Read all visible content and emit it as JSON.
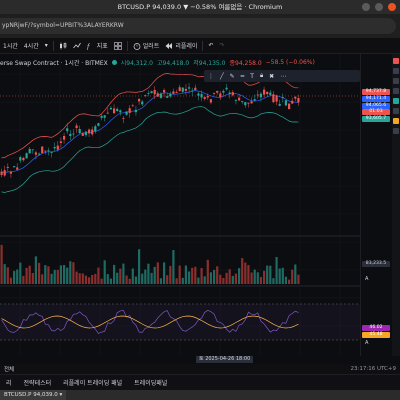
{
  "window": {
    "title": "BTCUSD.P 94,039.0 ▼ −0.58% 여름없음 · Chromium"
  },
  "urlbar": {
    "text": "ypNRjwF/?symbol=UPBIT%3ALAYERKRW"
  },
  "toolbar": {
    "interval": "1시간",
    "interval_alt": "4시간",
    "chart_type_icon": "candles-icon",
    "indicators_label": "지표",
    "alert_label": "얼러트",
    "replay_label": "리플레이",
    "undo_icon": "undo-icon",
    "redo_icon": "redo-icon"
  },
  "legend": {
    "symbol": "erse Swap Contract · 1시간 · BITMEX",
    "open": "시94,312.0",
    "high": "고94,418.0",
    "low": "저94,135.0",
    "close": "종94,258.0",
    "change": "−58.5 (−0.06%)"
  },
  "price_tags": [
    {
      "value": "94,737.8",
      "color": "#ef5350"
    },
    {
      "value": "94,171.4",
      "color": "#2962ff"
    },
    {
      "value": "94,065.6",
      "color": "#2962ff"
    },
    {
      "value": "01:03",
      "color": "#ef5350"
    },
    {
      "value": "93,605.7",
      "color": "#26a69a"
    }
  ],
  "volume_tag": "83,233.5",
  "osc_tags": [
    {
      "value": "46.02",
      "color": "#9c27b0"
    },
    {
      "value": "45.48",
      "color": "#f5a623"
    }
  ],
  "time_axis": {
    "cursor_label": "토 2025-04-26  18:00"
  },
  "footer": {
    "range_label": "전체",
    "clock": "23:17:16 UTC+9"
  },
  "bottom_panel": {
    "items": [
      "리",
      "전략테스터",
      "리플레이 트레이딩 패널",
      "트레이딩패널"
    ]
  },
  "taskbar": {
    "tab": "BTCUSD.P 94,039.0 ▾"
  },
  "colors": {
    "up": "#26a69a",
    "down": "#ef5350",
    "bb_upper": "#ef5350",
    "bb_lower": "#26a69a",
    "bb_basis": "#2962ff",
    "osc_line": "#7e57c2",
    "osc_signal": "#ffb74d"
  }
}
